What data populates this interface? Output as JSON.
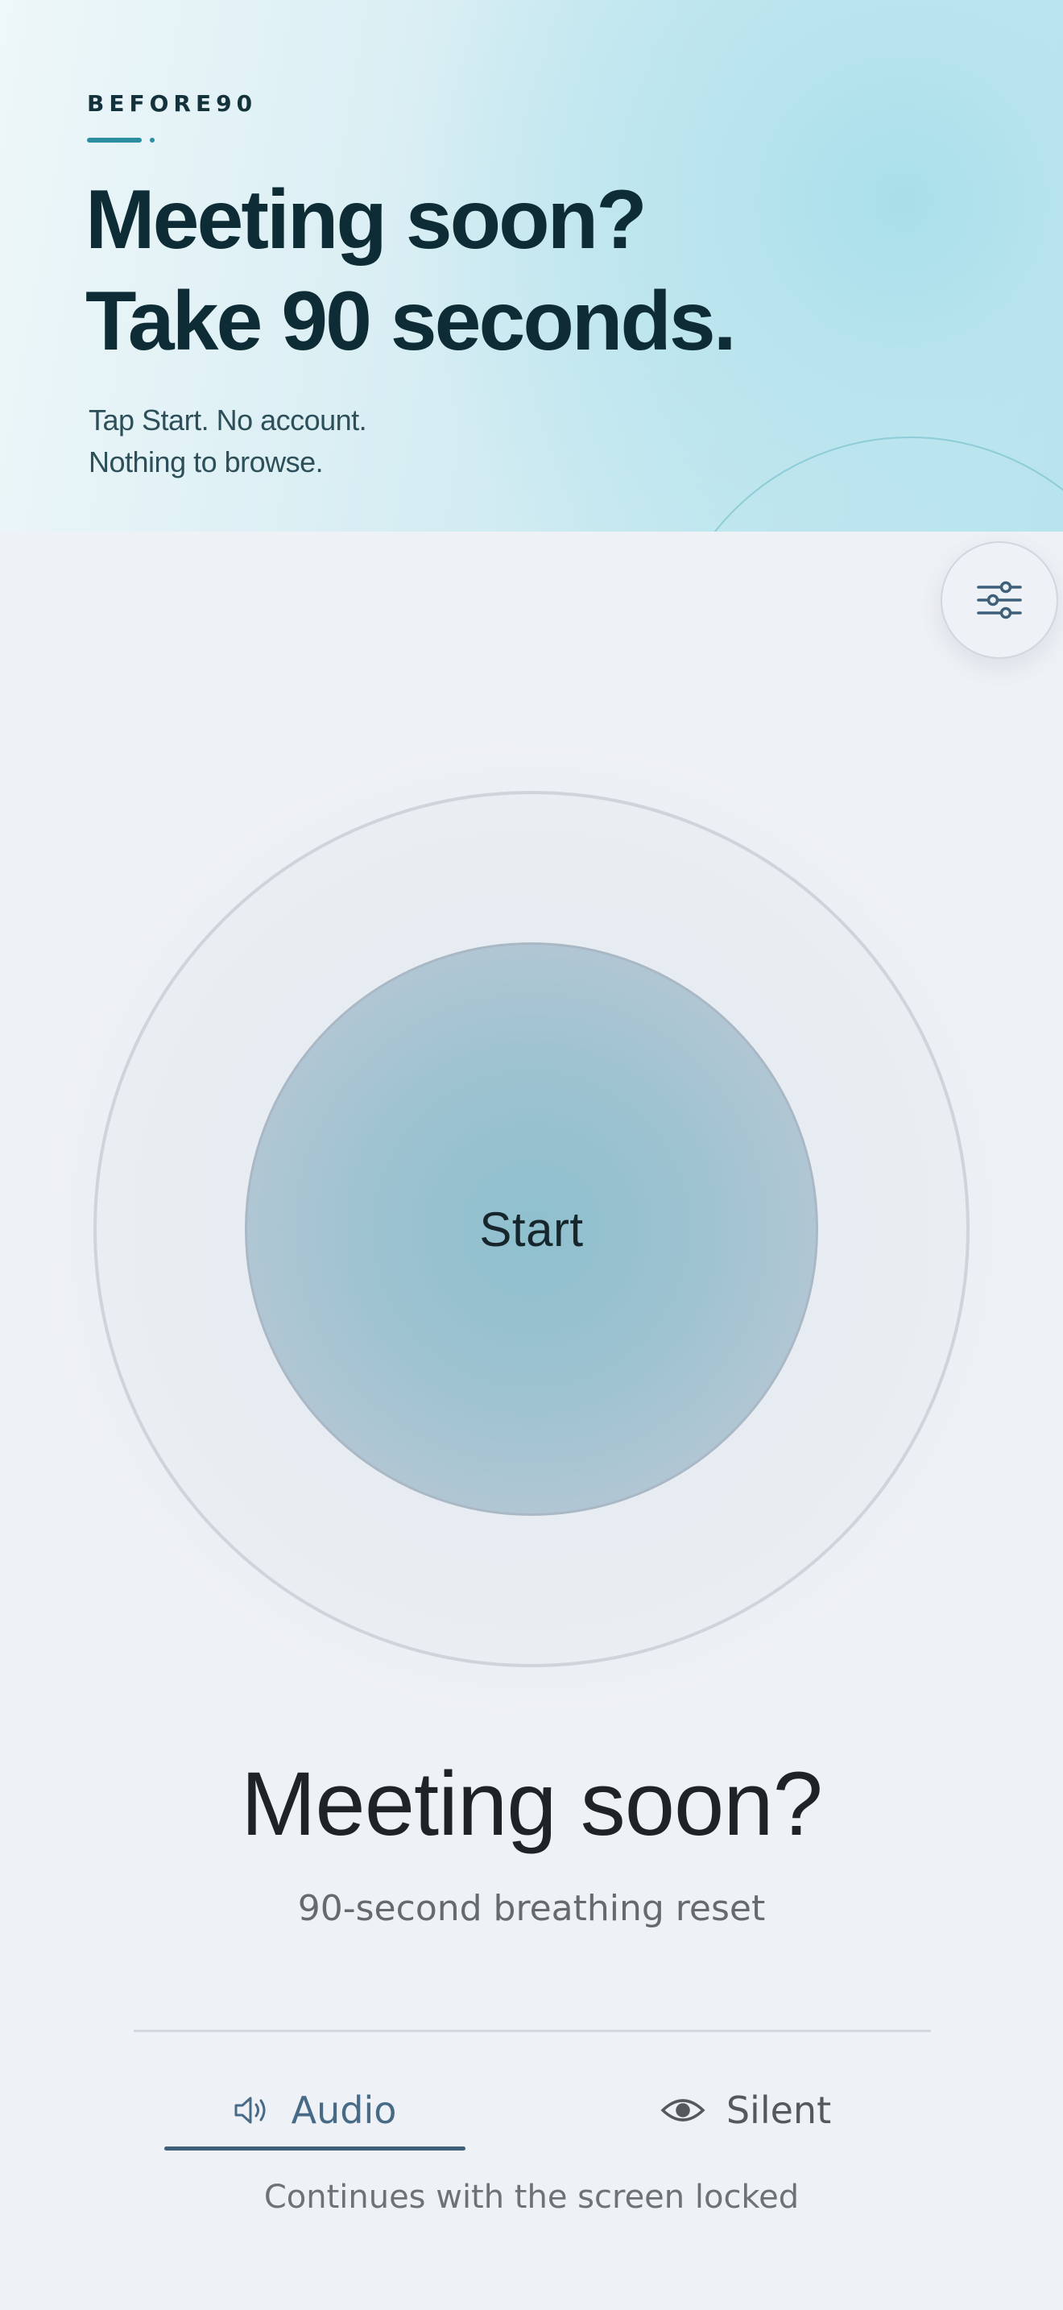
{
  "header": {
    "brand": "BEFORE90",
    "headline_line1": "Meeting soon?",
    "headline_line2": "Take 90 seconds.",
    "subline_line1": "Tap Start. No account.",
    "subline_line2": "Nothing to browse."
  },
  "settings": {
    "icon": "sliders-icon"
  },
  "breath": {
    "start_label": "Start"
  },
  "main": {
    "title": "Meeting soon?",
    "subtitle": "90-second breathing reset"
  },
  "modes": {
    "selected": "Audio",
    "items": [
      {
        "label": "Audio",
        "icon": "speaker-icon",
        "active": true
      },
      {
        "label": "Silent",
        "icon": "eye-icon",
        "active": false
      }
    ],
    "note": "Continues with the screen locked"
  },
  "colors": {
    "accent": "#2b8fa1",
    "active_tab": "#476a86",
    "headline": "#0e2c35",
    "background": "#eef1f5"
  }
}
